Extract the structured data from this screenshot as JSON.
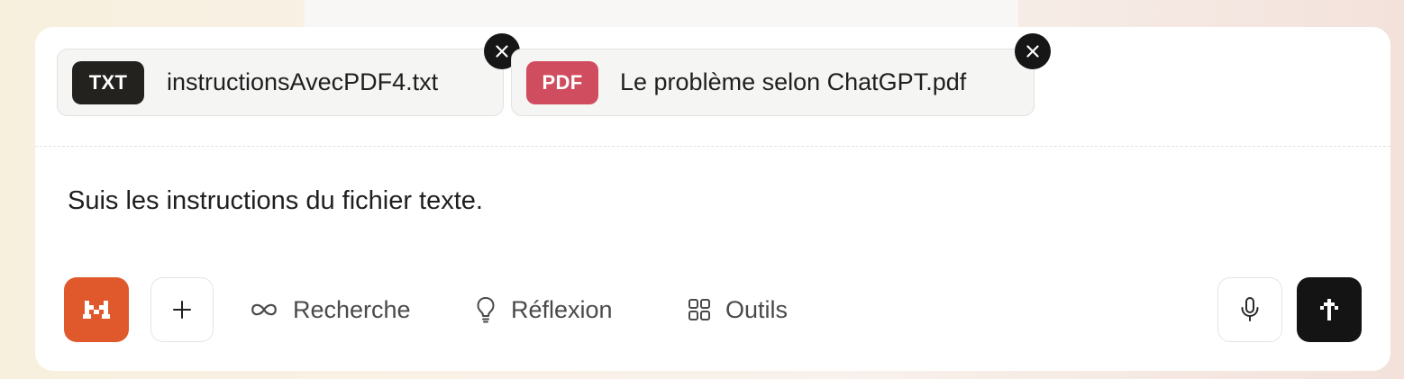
{
  "attachments": [
    {
      "badge": "TXT",
      "badge_color": "#23221f",
      "name": "instructionsAvecPDF4.txt"
    },
    {
      "badge": "PDF",
      "badge_color": "#d04d5f",
      "name": "Le problème selon ChatGPT.pdf"
    }
  ],
  "prompt": {
    "text": "Suis les instructions du fichier texte."
  },
  "toolbar": {
    "brand_color": "#e0592c",
    "brand_icon": "brand-logo-icon",
    "add_icon": "plus-icon",
    "tools": [
      {
        "icon": "infinity-icon",
        "label": "Recherche"
      },
      {
        "icon": "lightbulb-icon",
        "label": "Réflexion"
      },
      {
        "icon": "grid-icon",
        "label": "Outils"
      }
    ],
    "mic_icon": "microphone-icon",
    "send_icon": "send-arrow-icon"
  }
}
